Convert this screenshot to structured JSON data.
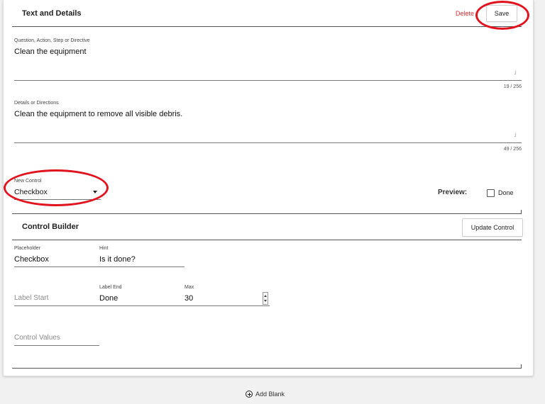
{
  "header": {
    "title": "Text and Details",
    "delete_label": "Delete",
    "save_label": "Save"
  },
  "question": {
    "label": "Question, Action, Step or Directive",
    "value": "Clean the equipment",
    "counter": "19 / 256"
  },
  "details": {
    "label": "Details or Directions",
    "value": "Clean the equipment to remove all visible debris.",
    "counter": "49 / 256"
  },
  "new_control": {
    "label": "New Control",
    "value": "Checkbox"
  },
  "preview": {
    "label": "Preview:",
    "checkbox_label": "Done",
    "checked": false
  },
  "control_builder": {
    "title": "Control Builder",
    "update_label": "Update Control",
    "placeholder": {
      "label": "Placeholder",
      "value": "Checkbox"
    },
    "hint": {
      "label": "Hint",
      "value": "Is it done?"
    },
    "label_start": {
      "placeholder": "Label Start"
    },
    "label_end": {
      "label": "Label End",
      "value": "Done"
    },
    "max": {
      "label": "Max",
      "value": "30"
    },
    "control_values": {
      "placeholder": "Control Values"
    }
  },
  "footer": {
    "add_blank_label": "Add Blank"
  },
  "colors": {
    "delete": "#d32f2f",
    "highlight": "#e0141e"
  },
  "icons": {
    "dropdown": "caret-down-icon",
    "add": "plus-circle-icon",
    "resize": "resize-handle-icon",
    "spinner": "spinner-icon"
  }
}
